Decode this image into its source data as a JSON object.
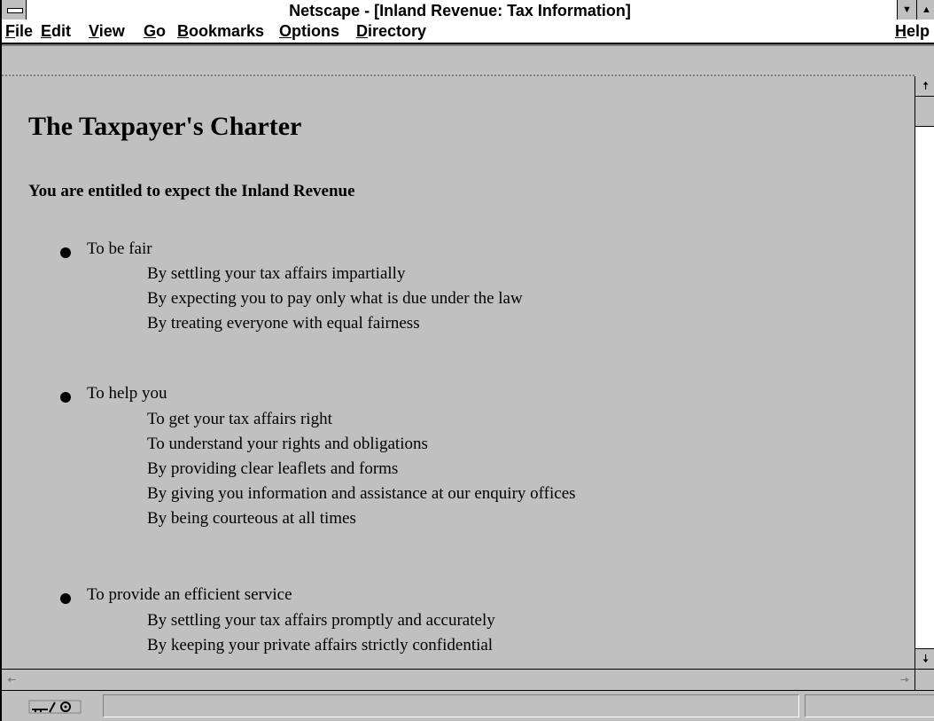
{
  "window": {
    "title": "Netscape - [Inland Revenue: Tax Information]",
    "minimize_glyph": "▼",
    "maximize_glyph": "▲"
  },
  "menu": {
    "items": [
      {
        "label": "File",
        "mnemonic": "F",
        "rest": "ile"
      },
      {
        "label": "Edit",
        "mnemonic": "E",
        "rest": "dit"
      },
      {
        "label": "View",
        "mnemonic": "V",
        "rest": "iew"
      },
      {
        "label": "Go",
        "mnemonic": "G",
        "rest": "o"
      },
      {
        "label": "Bookmarks",
        "mnemonic": "B",
        "rest": "ookmarks"
      },
      {
        "label": "Options",
        "mnemonic": "O",
        "rest": "ptions"
      },
      {
        "label": "Directory",
        "mnemonic": "D",
        "rest": "irectory"
      },
      {
        "label": "Help",
        "mnemonic": "H",
        "rest": "elp"
      }
    ]
  },
  "page": {
    "heading": "The Taxpayer's Charter",
    "intro": "You are entitled to expect the Inland Revenue",
    "sections": [
      {
        "title": "To be fair",
        "items": [
          "By settling your tax affairs impartially",
          "By expecting you to pay only what is due under the law",
          "By treating everyone with equal fairness"
        ]
      },
      {
        "title": "To help you",
        "items": [
          "To get your tax affairs right",
          "To understand your rights and obligations",
          "By providing clear leaflets and forms",
          "By giving you information and assistance at our enquiry offices",
          "By being courteous at all times"
        ]
      },
      {
        "title": "To provide an efficient service",
        "items": [
          "By settling your tax affairs promptly and accurately",
          "By keeping your private affairs strictly confidential"
        ]
      }
    ]
  },
  "scrollbar": {
    "up_glyph": "🠅",
    "down_glyph": "🠇",
    "left_glyph": "🠄",
    "right_glyph": "🠆"
  },
  "status": {
    "security_icon": "broken-key-icon",
    "text": ""
  }
}
